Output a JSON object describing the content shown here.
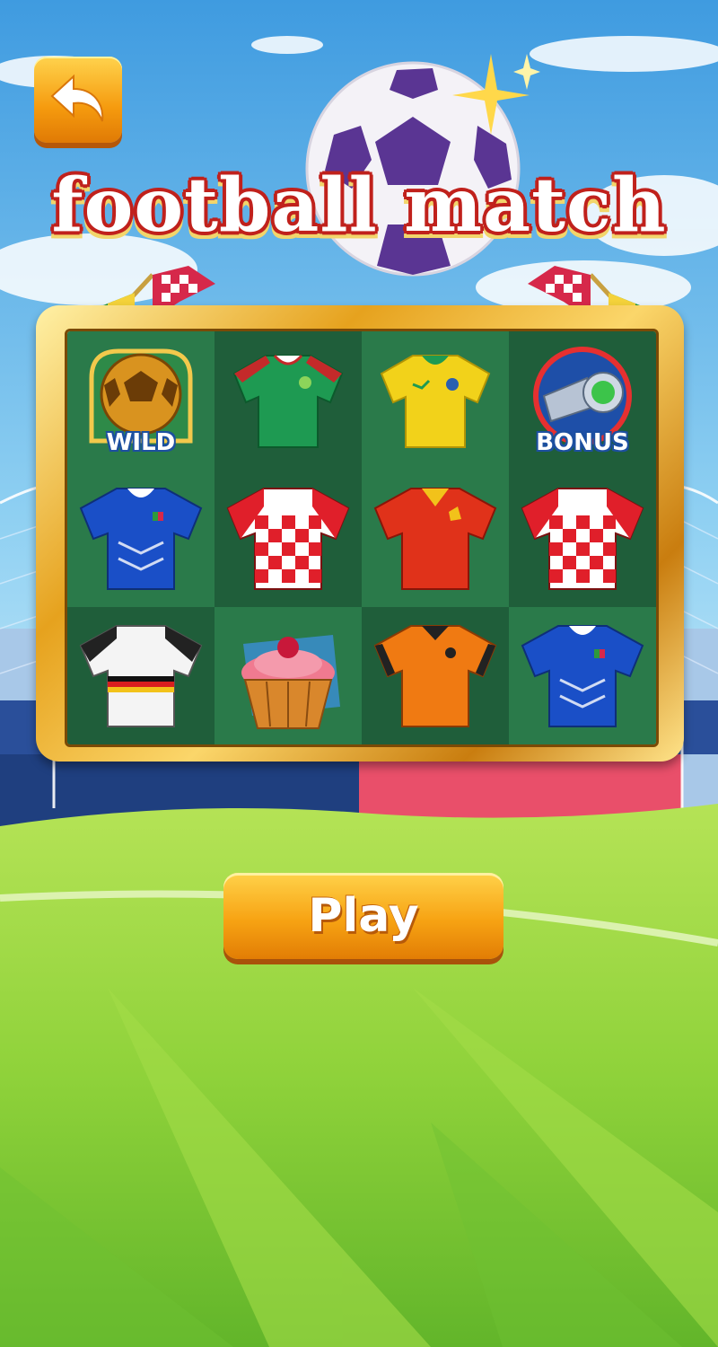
{
  "title": "football match",
  "back_button": {
    "icon": "back-arrow-icon"
  },
  "play_button": {
    "label": "Play"
  },
  "symbols": {
    "wild_label": "WILD",
    "bonus_label": "BONUS"
  },
  "grid": [
    [
      "wild-ball",
      "green-jersey",
      "yellow-jersey",
      "bonus-whistle"
    ],
    [
      "blue-jersey",
      "checkered-jersey",
      "red-jersey",
      "checkered-jersey"
    ],
    [
      "white-jersey",
      "cupcake",
      "orange-jersey",
      "blue-jersey"
    ]
  ],
  "colors": {
    "accent": "#f59a0e",
    "title_outline": "#c0211c",
    "board_green": "#2a7a4a"
  }
}
